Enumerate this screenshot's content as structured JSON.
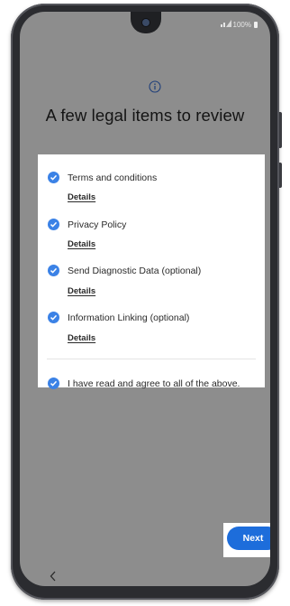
{
  "status_bar": {
    "battery": "100%",
    "signal_icon": "signal-icon",
    "battery_icon": "battery-icon"
  },
  "header": {
    "info_icon": "info-icon",
    "title": "A few legal items to review"
  },
  "legal_items": [
    {
      "label": "Terms and conditions",
      "details_link": "Details",
      "checked": true
    },
    {
      "label": "Privacy Policy",
      "details_link": "Details",
      "checked": true
    },
    {
      "label": "Send Diagnostic Data (optional)",
      "details_link": "Details",
      "checked": true
    },
    {
      "label": "Information Linking (optional)",
      "details_link": "Details",
      "checked": true
    }
  ],
  "agree_all": {
    "label": "I have read and agree to all of the above.",
    "checked": true
  },
  "actions": {
    "next_label": "Next"
  },
  "nav": {
    "back_icon": "back-chevron-icon"
  },
  "colors": {
    "accent": "#1d6ddb",
    "checkbox": "#3b82e6",
    "screen_dim": "#8d8d8d"
  }
}
